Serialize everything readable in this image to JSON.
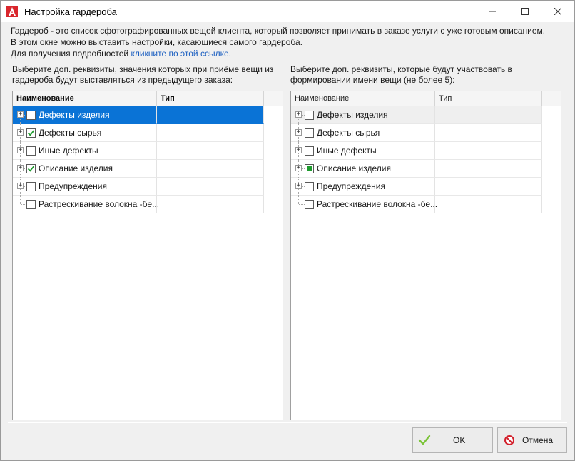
{
  "window": {
    "title": "Настройка гардероба",
    "controls": {
      "minimize": "—",
      "maximize": "☐",
      "close": "✕"
    }
  },
  "intro": {
    "line1": "Гардероб - это список сфотографированных вещей клиента, который позволяет принимать в заказе услуги с уже готовым описанием.",
    "line2": "В этом окне можно выставить настройки, касающиеся самого гардероба.",
    "line3_prefix": "Для получения подробностей ",
    "link": "кликните по этой ссылке."
  },
  "left_panel": {
    "caption_line1": "Выберите доп. реквизиты, значения которых при приёме вещи из",
    "caption_line2": "гардероба будут выставляться из предыдущего заказа:",
    "columns": {
      "name": "Наименование",
      "type": "Тип"
    },
    "rows": [
      {
        "label": "Дефекты изделия",
        "checked": false,
        "expandable": true,
        "selected": true
      },
      {
        "label": "Дефекты сырья",
        "checked": true,
        "expandable": true
      },
      {
        "label": "Иные дефекты",
        "checked": false,
        "expandable": true
      },
      {
        "label": "Описание изделия",
        "checked": true,
        "expandable": true
      },
      {
        "label": "Предупреждения",
        "checked": false,
        "expandable": true
      },
      {
        "label": "Растрескивание волокна -бе...",
        "checked": false,
        "expandable": false
      }
    ]
  },
  "right_panel": {
    "caption_line1": "Выберите доп. реквизиты, которые будут участвовать в",
    "caption_line2": "формировании имени вещи (не более 5):",
    "columns": {
      "name": "Наименование",
      "type": "Тип"
    },
    "rows": [
      {
        "label": "Дефекты изделия",
        "state": "unchecked",
        "expandable": true,
        "hover": true
      },
      {
        "label": "Дефекты сырья",
        "state": "unchecked",
        "expandable": true
      },
      {
        "label": "Иные дефекты",
        "state": "unchecked",
        "expandable": true
      },
      {
        "label": "Описание изделия",
        "state": "indeterminate",
        "expandable": true
      },
      {
        "label": "Предупреждения",
        "state": "unchecked",
        "expandable": true
      },
      {
        "label": "Растрескивание волокна -бе...",
        "state": "unchecked",
        "expandable": false
      }
    ]
  },
  "buttons": {
    "ok": "OK",
    "cancel": "Отмена"
  },
  "colors": {
    "selection": "#0a73d6",
    "link": "#1a5ec0",
    "check_green": "#1e9b2e",
    "app_icon_red": "#d9262c"
  }
}
